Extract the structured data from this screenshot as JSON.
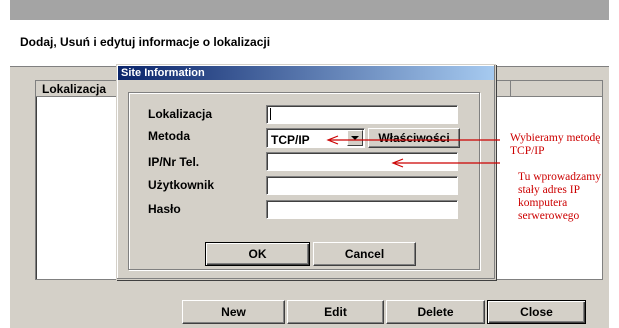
{
  "window": {
    "header_text": "Dodaj, Usuń i edytuj informacje o lokalizacji"
  },
  "list": {
    "column_header": "Lokalizacja"
  },
  "main_buttons": {
    "new": "New",
    "edit": "Edit",
    "delete": "Delete",
    "close": "Close"
  },
  "dialog": {
    "title": "Site Information",
    "fields": {
      "location_label": "Lokalizacja",
      "location_value": "",
      "method_label": "Metoda",
      "method_value": "TCP/IP",
      "properties_button": "Właściwości",
      "ip_label": "IP/Nr Tel.",
      "ip_value": "",
      "user_label": "Użytkownik",
      "user_value": "",
      "password_label": "Hasło",
      "password_value": ""
    },
    "ok": "OK",
    "cancel": "Cancel"
  },
  "annotations": {
    "method_note_line1": "Wybieramy metodę",
    "method_note_line2": "TCP/IP",
    "ip_note_line1": "Tu wprowadzamy",
    "ip_note_line2": "stały adres IP",
    "ip_note_line3": "komputera",
    "ip_note_line4": "serwerowego",
    "color": "#cc0000"
  },
  "icons": {
    "dropdown": "chevron-down-icon"
  }
}
